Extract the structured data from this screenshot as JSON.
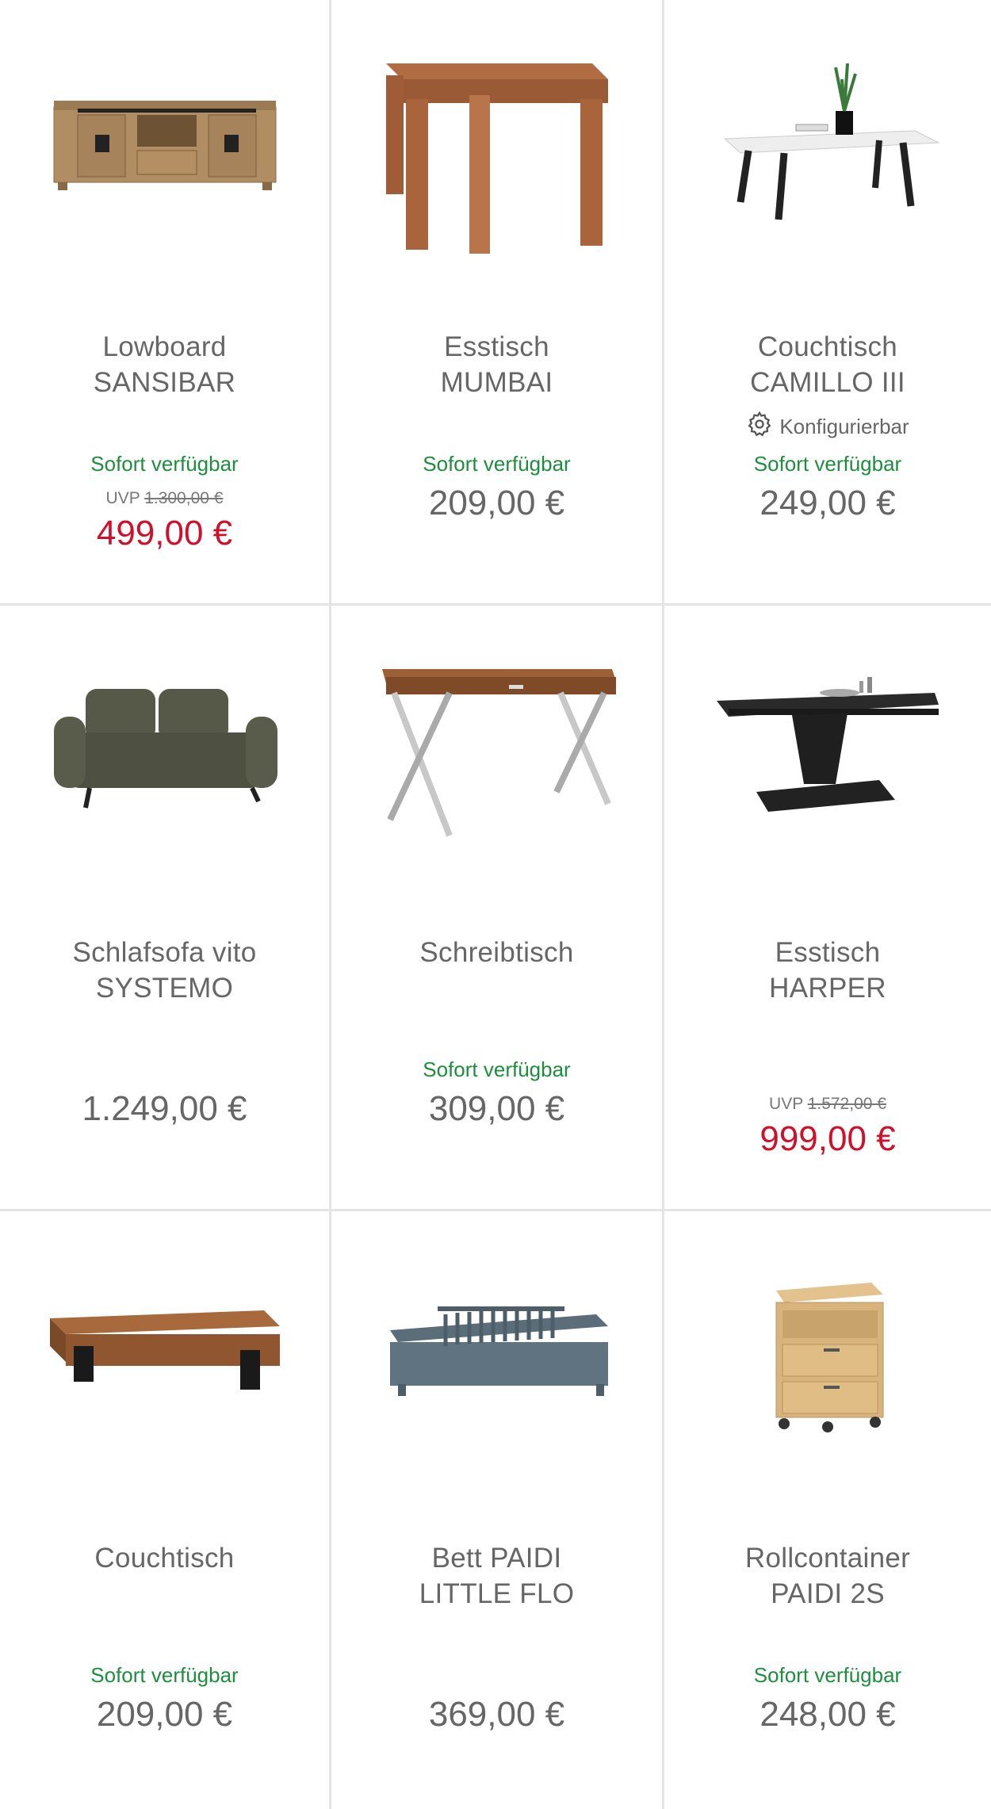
{
  "products": [
    {
      "name1": "Lowboard",
      "name2": "SANSIBAR",
      "availability": "Sofort verfügbar",
      "uvp_label": "UVP",
      "uvp_price": "1.300,00 €",
      "price": "499,00 €",
      "sale": true,
      "icon": "lowboard-image"
    },
    {
      "name1": "Esstisch",
      "name2": "MUMBAI",
      "availability": "Sofort verfügbar",
      "price": "209,00 €",
      "sale": false,
      "icon": "dining-table-image"
    },
    {
      "name1": "Couchtisch",
      "name2": "CAMILLO III",
      "config": "Konfigurierbar",
      "availability": "Sofort verfügbar",
      "price": "249,00 €",
      "sale": false,
      "icon": "coffee-table-image"
    },
    {
      "name1": "Schlafsofa vito",
      "name2": "SYSTEMO",
      "price": "1.249,00 €",
      "sale": false,
      "icon": "sofa-image"
    },
    {
      "name1": "Schreibtisch",
      "availability": "Sofort verfügbar",
      "price": "309,00 €",
      "sale": false,
      "icon": "desk-image"
    },
    {
      "name1": "Esstisch",
      "name2": "HARPER",
      "uvp_label": "UVP",
      "uvp_price": "1.572,00 €",
      "price": "999,00 €",
      "sale": true,
      "icon": "extendable-table-image"
    },
    {
      "name1": "Couchtisch",
      "availability": "Sofort verfügbar",
      "price": "209,00 €",
      "sale": false,
      "icon": "wooden-coffee-table-image"
    },
    {
      "name1": "Bett PAIDI",
      "name2": "LITTLE FLO",
      "price": "369,00 €",
      "sale": false,
      "icon": "kids-bed-image"
    },
    {
      "name1": "Rollcontainer",
      "name2": "PAIDI 2S",
      "availability": "Sofort verfügbar",
      "price": "248,00 €",
      "sale": false,
      "icon": "rolling-cabinet-image"
    }
  ],
  "colors": {
    "available": "#1e8e3e",
    "sale": "#d0102a",
    "price": "#666666",
    "divider": "#e4e4e4"
  }
}
